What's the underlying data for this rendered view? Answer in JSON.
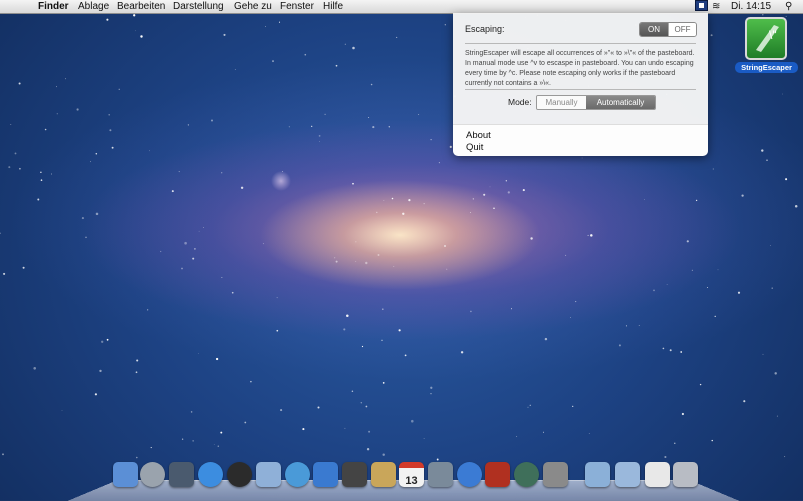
{
  "menubar": {
    "apple": "",
    "items": [
      "Finder",
      "Ablage",
      "Bearbeiten",
      "Darstellung",
      "Gehe zu",
      "Fenster",
      "Hilfe"
    ],
    "wifi_glyph": "≋",
    "clock": "Di. 14:15",
    "spotlight_glyph": "⚲"
  },
  "popup": {
    "escaping_label": "Escaping:",
    "switch_on": "ON",
    "switch_off": "OFF",
    "description": "StringEscaper will escape all occurrences of »\"« to »\\\"« of the pasteboard. In manual mode use ^v to escaspe in pasteboard. You can undo escaping every time by ^c. Please note escaping only works if the pasteboard currently not contains a »\\«.",
    "mode_label": "Mode:",
    "mode_manual": "Manually",
    "mode_auto": "Automatically",
    "about": "About",
    "quit": "Quit"
  },
  "app_icon": {
    "label": "StringEscaper",
    "glyph": "\\\""
  },
  "dock": {
    "icons": [
      {
        "name": "finder-icon",
        "color": "#5b8fd6"
      },
      {
        "name": "launchpad-icon",
        "color": "#9aa3ad"
      },
      {
        "name": "mission-control-icon",
        "color": "#4a5a6e"
      },
      {
        "name": "app-store-icon",
        "color": "#3c8de0"
      },
      {
        "name": "dashboard-icon",
        "color": "#2b2b2b"
      },
      {
        "name": "mail-icon",
        "color": "#8fb0d8"
      },
      {
        "name": "safari-icon",
        "color": "#4a9ad8"
      },
      {
        "name": "facetime-icon",
        "color": "#3a7ad0"
      },
      {
        "name": "photo-booth-icon",
        "color": "#444"
      },
      {
        "name": "address-book-icon",
        "color": "#c9a65a"
      },
      {
        "name": "ical-icon",
        "color": "#f2f2f2"
      },
      {
        "name": "preview-icon",
        "color": "#7a8a9a"
      },
      {
        "name": "itunes-icon",
        "color": "#3b7bd4"
      },
      {
        "name": "photo-icon",
        "color": "#b03020"
      },
      {
        "name": "time-machine-icon",
        "color": "#3f6f5a"
      },
      {
        "name": "system-preferences-icon",
        "color": "#8a8a8a"
      },
      {
        "name": "applications-folder-icon",
        "color": "#8bb0d8"
      },
      {
        "name": "documents-folder-icon",
        "color": "#9ab8dc"
      },
      {
        "name": "downloads-stack-icon",
        "color": "#e8e8e8"
      },
      {
        "name": "trash-icon",
        "color": "#b8bcc4"
      }
    ],
    "calendar_day": "13"
  }
}
